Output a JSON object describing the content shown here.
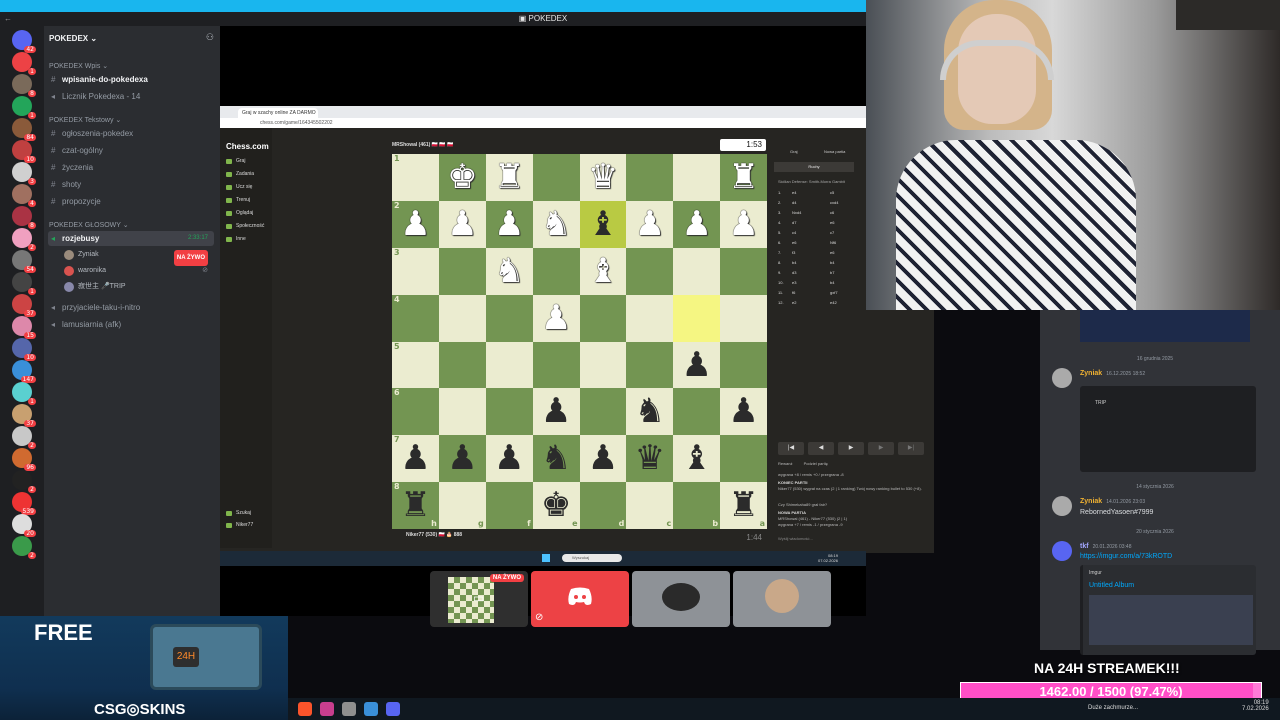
{
  "window": {
    "title": "POKEDEX"
  },
  "server": {
    "name": "POKEDEX"
  },
  "rail_badges": [
    "42",
    "1",
    "8",
    "1",
    "84",
    "10",
    "3",
    "4",
    "8",
    "2",
    "54",
    "1",
    "37",
    "15",
    "10",
    "147",
    "1",
    "37",
    "2",
    "96",
    "2",
    "539",
    "20",
    "2"
  ],
  "sidebar": {
    "cat_wpis": "POKEDEX Wpis",
    "ch_wpisanie": "wpisanie-do-pokedexa",
    "ch_licznik": "Licznik Pokedexa - 14",
    "cat_tekstowy": "POKEDEX Tekstowy",
    "ch_ogloszenia": "ogłoszenia-pokedex",
    "ch_czat": "czat-ogólny",
    "ch_zyczenia": "życzenia",
    "ch_shoty": "shoty",
    "ch_propozycje": "propozycje",
    "cat_glosowy": "POKEDEX GŁOSOWY",
    "ch_rozjebusy": "rozjebusy",
    "voice_timer": "2:33:17",
    "users": [
      "Zyniak",
      "waronika",
      "寂世主 🎤TRIP"
    ],
    "live_label": "NA ŻYWO",
    "ch_przyjaciele": "przyjaciele-taku-i-nitro",
    "ch_lamusiarnia": "lamusiarnia (afk)"
  },
  "browser": {
    "tab_title": "Graj w szachy online ZA DARMO",
    "url": "chess.com/game/164345502202"
  },
  "chess": {
    "logo": "Chess.com",
    "nav": [
      "Graj",
      "Zadania",
      "Ucz się",
      "Trenuj",
      "Oglądaj",
      "Społeczność",
      "Inne"
    ],
    "nav_bottom": [
      "Szukaj",
      "Niker77"
    ],
    "top_player": "MRShowal (461) 🇵🇱 🇵🇱 🇵🇱",
    "top_clock": "1:53",
    "bottom_player": "Niker77 (530) 🇵🇱 🎂 888",
    "bottom_clock": "1:44",
    "files": [
      "h",
      "g",
      "f",
      "e",
      "d",
      "c",
      "b",
      "a"
    ],
    "ranks": [
      "1",
      "2",
      "3",
      "4",
      "5",
      "6",
      "7",
      "8"
    ],
    "board": [
      [
        "",
        "wK",
        "wR",
        "",
        "wQ",
        "",
        "",
        "wR"
      ],
      [
        "wP",
        "wP",
        "wP",
        "wN",
        "bB",
        "wP",
        "wP",
        "wP"
      ],
      [
        "",
        "",
        "wN",
        "",
        "wB",
        "",
        "",
        ""
      ],
      [
        "",
        "",
        "",
        "wP",
        "",
        "",
        "",
        ""
      ],
      [
        "",
        "",
        "",
        "",
        "",
        "",
        "bP",
        ""
      ],
      [
        "",
        "",
        "",
        "bP",
        "",
        "bN",
        "",
        "bP"
      ],
      [
        "bP",
        "bP",
        "bP",
        "bN",
        "bP",
        "bQ",
        "bB",
        ""
      ],
      [
        "bR",
        "",
        "",
        "bK",
        "",
        "",
        "",
        "bR"
      ]
    ],
    "panel_tabs": [
      "Graj",
      "Nowa partia"
    ],
    "panel_subtab": "Ruchy",
    "opening": "Sicilian Defense: Smith-Morra Gambit",
    "moves": [
      [
        "1.",
        "e4",
        "c5"
      ],
      [
        "2.",
        "d4",
        "cxd4"
      ],
      [
        "3.",
        "Nxd4",
        "c6"
      ],
      [
        "4.",
        "d7",
        "e6"
      ],
      [
        "5.",
        "c4",
        "c7"
      ],
      [
        "6.",
        "e6",
        "Nf6"
      ],
      [
        "7.",
        "f3",
        "e6"
      ],
      [
        "8.",
        "b4",
        "b4"
      ],
      [
        "9.",
        "d3",
        "b7"
      ],
      [
        "10.",
        "e3",
        "b4"
      ],
      [
        "11.",
        "f6",
        "gxf7"
      ],
      [
        "12.",
        "e2",
        "e42"
      ]
    ],
    "nav_buttons": [
      "|◀",
      "◀",
      "▶",
      "▶",
      "▶|"
    ],
    "rematch": "Rewanż",
    "share": "Podziel partię",
    "log_1": "wygrana +8 / remis +0 / przegrana -8",
    "log_2": "KONIEC PARTII",
    "log_3": "Niker77 (530) wygrał na czas (2 | 1 ranking) Twój nowy ranking bullet to 530 (+8).",
    "log_4": "Czy Shimekaha89 grał fair?",
    "log_5": "NOWA PARTIA",
    "log_6": "MRShowal (461) - Niker77 (530) (2 | 1)",
    "log_7": "wygrana +7 / remis -1 / przegrana -9",
    "chat_placeholder": "Wyślij wiadomość..."
  },
  "windows_taskbar": {
    "search": "Wyszukaj",
    "clock": "08:19",
    "date": "07.02.2026"
  },
  "tiles": {
    "live": "NA ŻYWO"
  },
  "chat": {
    "date_1": "16 grudnia 2025",
    "m1_name": "Zyniak",
    "m1_time": "16.12.2025 18:52",
    "m1_embed_title": "TRIP",
    "date_2": "14 stycznia 2026",
    "m2_name": "Zyniak",
    "m2_time": "14.01.2026 23:03",
    "m2_text": "RebornedYasoen#7999",
    "date_3": "20 stycznia 2026",
    "m3_name": "tkf",
    "m3_time": "20.01.2026 03:48",
    "m3_link": "https://imgur.com/a/73kROTD",
    "m3_embed_site": "Imgur",
    "m3_embed_title": "Untitled Album"
  },
  "overlay": {
    "goal_title": "NA 24H STREAMEK!!!",
    "goal_value": "1462.00 / 1500 (97.47%)",
    "goal_progress": 0.9747
  },
  "ad": {
    "free": "FREE",
    "brand": "CSG◎SKINS",
    "chest_label": "24H"
  },
  "tray": {
    "weather": "Duże zachmurze...",
    "time": "08:19",
    "date": "7.02.2026"
  },
  "colors": {
    "discord_bg": "#313338",
    "sidebar_bg": "#2b2d31",
    "rail_bg": "#1e1f22",
    "chess_light": "#ebecd0",
    "chess_dark": "#739552",
    "live_red": "#f23f43",
    "goal_pink": "#ff7ad7",
    "link_blue": "#00a8fc"
  }
}
